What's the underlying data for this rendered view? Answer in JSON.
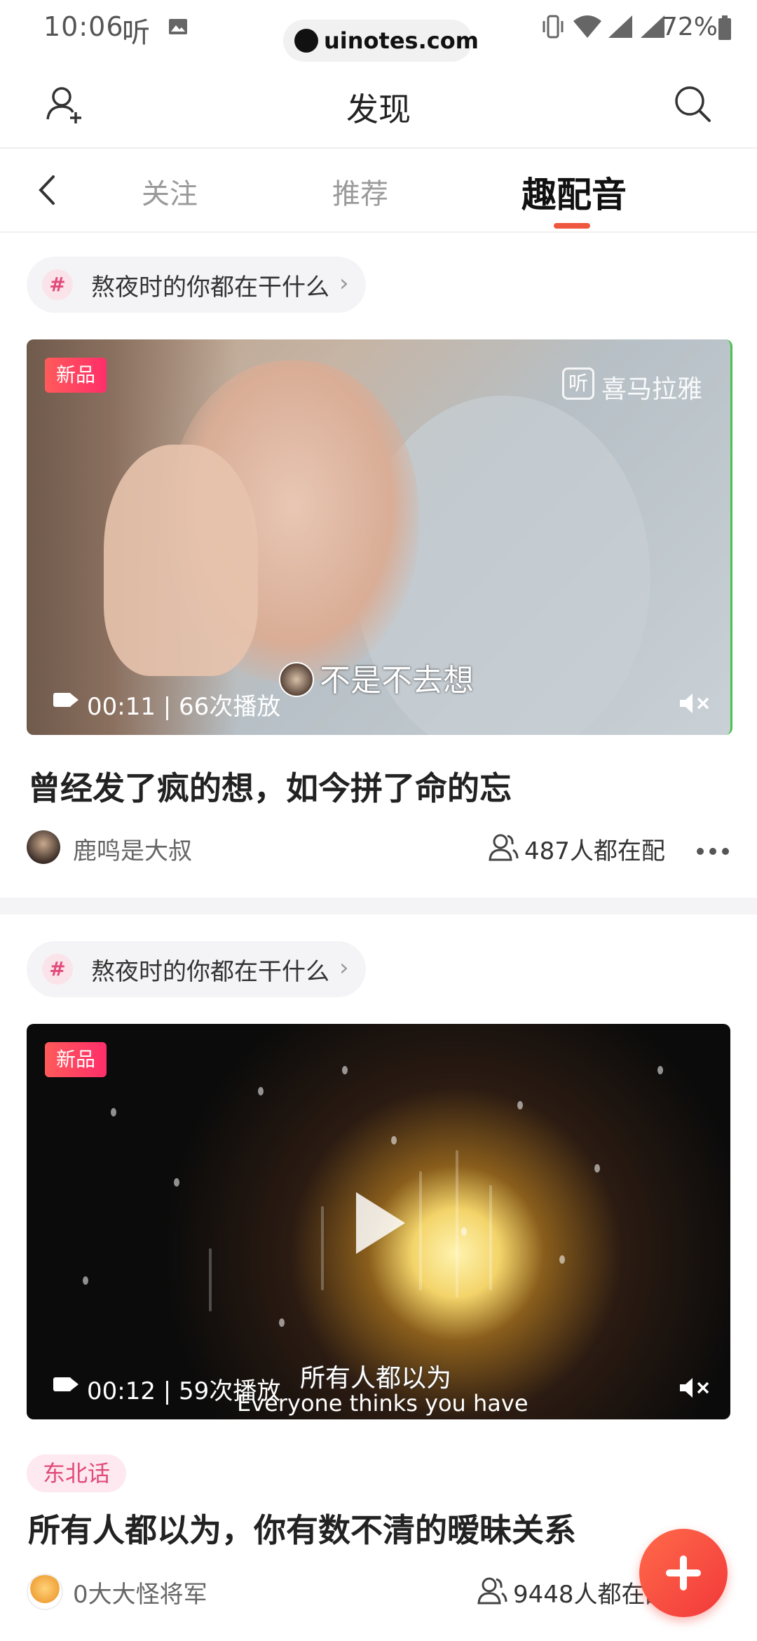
{
  "status_bar": {
    "time": "10:06",
    "app_glyph": "听",
    "url": "uinotes.com",
    "battery": "72%"
  },
  "header": {
    "title": "发现"
  },
  "tabs": [
    {
      "label": "关注",
      "active": false
    },
    {
      "label": "推荐",
      "active": false
    },
    {
      "label": "趣配音",
      "active": true
    }
  ],
  "feed": [
    {
      "topic": "熬夜时的你都在干什么",
      "badge": "新品",
      "watermark": "喜马拉雅",
      "watermark_glyph": "听",
      "video_meta": "00:11 | 66次播放",
      "subtitle": "不是不去想",
      "title": "曾经发了疯的想，如今拼了命的忘",
      "author": "鹿鸣是大叔",
      "dub_count": "487人都在配"
    },
    {
      "topic": "熬夜时的你都在干什么",
      "badge": "新品",
      "video_meta": "00:12 | 59次播放",
      "subtitle": "所有人都以为",
      "subtitle_en": "Everyone thinks you have",
      "tag": "东北话",
      "title": "所有人都以为，你有数不清的暧昧关系",
      "author": "0大大怪将军",
      "dub_count": "9448人都在配"
    }
  ],
  "colors": {
    "accent": "#f0573f",
    "tag_pink": "#e14a7b",
    "fab": "#f2383a"
  }
}
